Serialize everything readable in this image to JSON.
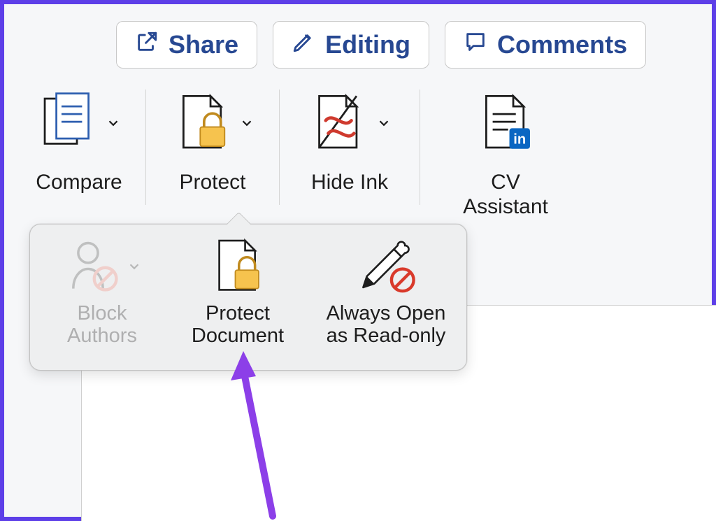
{
  "toolbar": {
    "share": "Share",
    "editing": "Editing",
    "comments": "Comments"
  },
  "ribbon": {
    "compare": "Compare",
    "protect": "Protect",
    "hide_ink": "Hide Ink",
    "cv_assistant_line1": "CV",
    "cv_assistant_line2": "Assistant"
  },
  "popover": {
    "block_authors_line1": "Block",
    "block_authors_line2": "Authors",
    "protect_doc_line1": "Protect",
    "protect_doc_line2": "Document",
    "read_only_line1": "Always Open",
    "read_only_line2": "as Read-only"
  }
}
